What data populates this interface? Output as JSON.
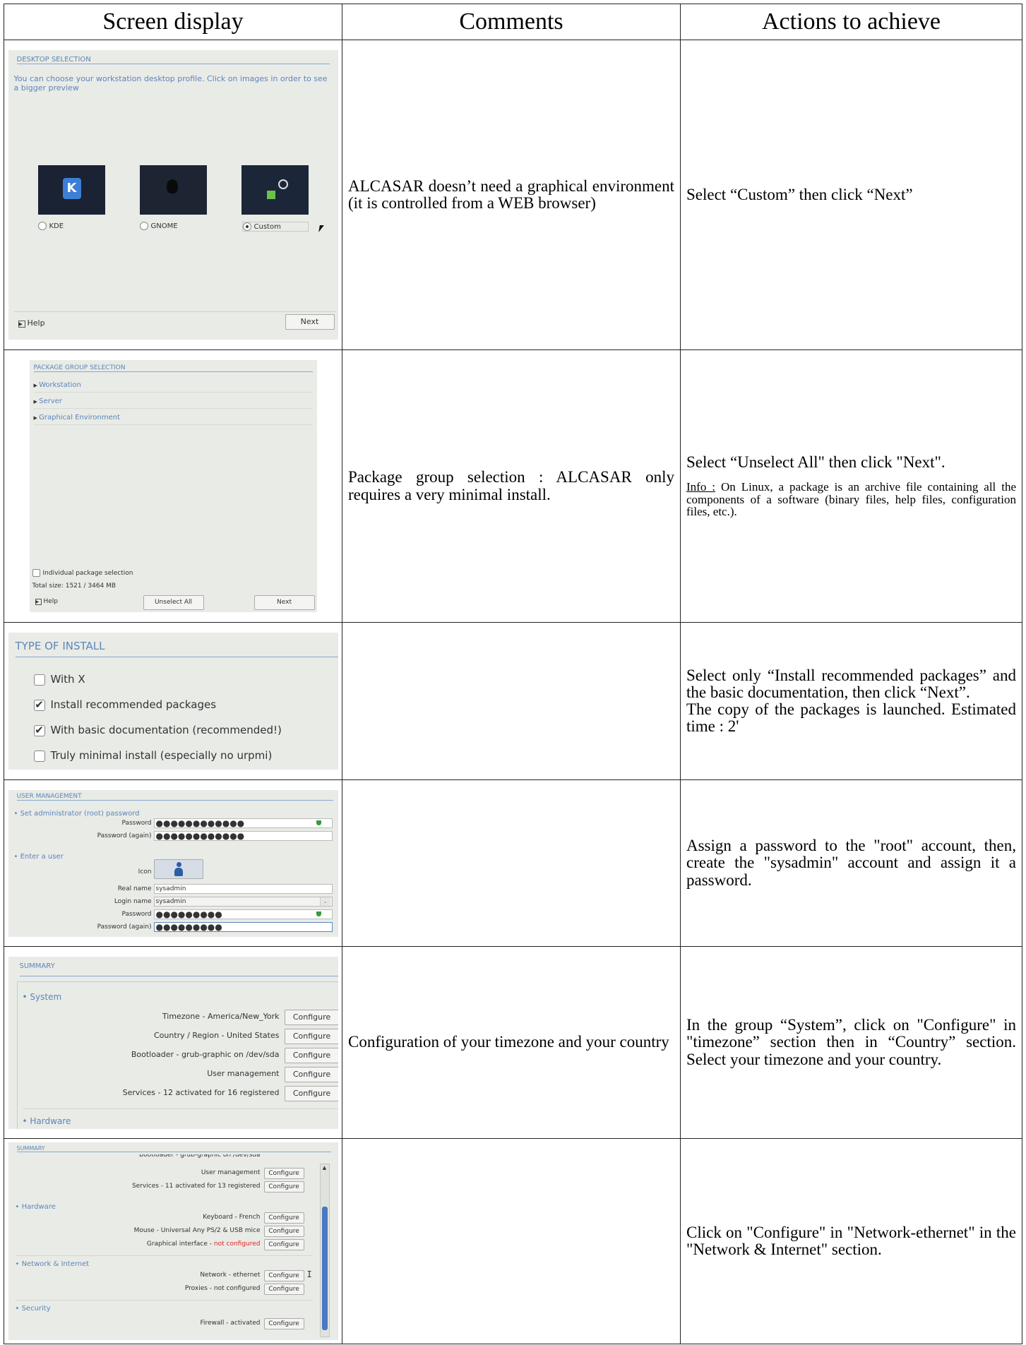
{
  "headers": [
    "Screen display",
    "Comments",
    "Actions to achieve"
  ],
  "rows": [
    {
      "comment": "ALCASAR doesn’t need a graphical environment (it is controlled from a WEB browser)",
      "action": "Select “Custom” then click “Next”",
      "screen": {
        "title": "DESKTOP SELECTION",
        "intro": "You can choose your workstation desktop profile. Click on images in order to see a bigger preview",
        "options": [
          "KDE",
          "GNOME",
          "Custom"
        ],
        "selected": "Custom",
        "help": "Help",
        "next": "Next"
      }
    },
    {
      "comment": "Package group selection : ALCASAR only requires a very minimal install.",
      "action": "Select “Unselect All\" then click \"Next\".",
      "info_label": "Info :",
      "info_text": " On Linux, a package is an archive file containing all the components of a software (binary files, help files, configuration files, etc.).",
      "screen": {
        "title": "PACKAGE GROUP SELECTION",
        "groups": [
          "Workstation",
          "Server",
          "Graphical Environment"
        ],
        "individual": "Individual package selection",
        "total": "Total size: 1521 / 3464 MB",
        "help": "Help",
        "unselect": "Unselect All",
        "next": "Next"
      }
    },
    {
      "comment": "",
      "action": "Select only “Install recommended packages” and the basic documentation, then click “Next”.",
      "action2": "The copy of the packages is launched. Estimated time : 2'",
      "screen": {
        "title": "TYPE OF INSTALL",
        "options": [
          {
            "label": "With X",
            "checked": false
          },
          {
            "label": "Install recommended packages",
            "checked": true
          },
          {
            "label": "With basic documentation (recommended!)",
            "checked": true
          },
          {
            "label": "Truly minimal install (especially no urpmi)",
            "checked": false
          }
        ]
      }
    },
    {
      "comment": "",
      "action": "Assign a password to the \"root\" account, then, create the \"sysadmin\" account and assign it a password.",
      "screen": {
        "title": "USER MANAGEMENT",
        "admin_section": "• Set administrator (root) password",
        "password_label": "Password",
        "password_again_label": "Password (again)",
        "root_pw": "●●●●●●●●●●●●",
        "root_pw2": "●●●●●●●●●●●●",
        "user_section": "• Enter a user",
        "icon_label": "Icon",
        "real_name_label": "Real name",
        "real_name": "sysadmin",
        "login_label": "Login name",
        "login": "sysadmin",
        "user_pw": "●●●●●●●●●",
        "user_pw2": "●●●●●●●●●"
      }
    },
    {
      "comment": "Configuration of your timezone and your country",
      "action": "In the group “System”, click on \"Configure\" in \"timezone” section then in “Country” section. Select your timezone and your country.",
      "screen": {
        "title": "SUMMARY",
        "system": "• System",
        "items": [
          "Timezone - America/New_York",
          "Country / Region - United States",
          "Bootloader - grub-graphic on /dev/sda",
          "User management",
          "Services - 12 activated for 16 registered"
        ],
        "configure": "Configure",
        "hardware": "• Hardware"
      }
    },
    {
      "comment": "",
      "action": "Click on \"Configure\" in \"Network-ethernet\" in the \"Network & Internet\" section.",
      "screen": {
        "title": "SUMMARY",
        "cut": "Bootloader - grub-graphic on /dev/sda",
        "top_items": [
          "User management",
          "Services - 11 activated for 13 registered"
        ],
        "hardware": "• Hardware",
        "hw_items": [
          "Keyboard - French",
          "Mouse - Universal Any PS/2 & USB mice"
        ],
        "gfx": "Graphical interface - ",
        "gfx_status": "not configured",
        "network": "• Network & Internet",
        "net_items": [
          "Network - ethernet",
          "Proxies - not configured"
        ],
        "security": "• Security",
        "sec_items": [
          "Firewall - activated"
        ],
        "configure": "Configure"
      }
    }
  ]
}
